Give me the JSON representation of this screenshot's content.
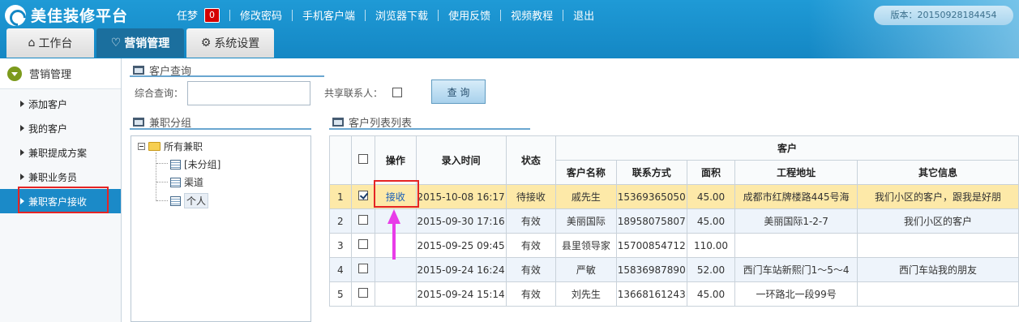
{
  "app": {
    "title": "美佳装修平台",
    "version": "版本：20150928184454"
  },
  "topnav": {
    "user": "任梦",
    "badge": "0",
    "items": [
      "修改密码",
      "手机客户端",
      "浏览器下载",
      "使用反馈",
      "视频教程",
      "退出"
    ]
  },
  "tabs": [
    {
      "label": "工作台",
      "icon": "home-icon"
    },
    {
      "label": "营销管理",
      "icon": "chat-icon"
    },
    {
      "label": "系统设置",
      "icon": "gear-icon"
    }
  ],
  "leftnav": {
    "title": "营销管理",
    "items": [
      "添加客户",
      "我的客户",
      "兼职提成方案",
      "兼职业务员",
      "兼职客户接收"
    ]
  },
  "query": {
    "section": "客户查询",
    "search_label": "综合查询：",
    "search_value": "",
    "share_label": "共享联系人：",
    "button": "查 询"
  },
  "groups": {
    "section": "兼职分组",
    "root": "所有兼职",
    "children": [
      "[未分组]",
      "渠道",
      "个人"
    ]
  },
  "list": {
    "section": "客户列表列表",
    "headers": {
      "op": "操作",
      "time": "录入时间",
      "status": "状态",
      "customer": "客户",
      "name": "客户名称",
      "contact": "联系方式",
      "area": "面积",
      "addr": "工程地址",
      "other": "其它信息"
    },
    "rows": [
      {
        "no": "1",
        "op": "接收",
        "time": "2015-10-08 16:17",
        "status": "待接收",
        "name": "戚先生",
        "contact": "15369365050",
        "area": "45.00",
        "addr": "成都市红牌楼路445号海",
        "other": "我们小区的客户，跟我是好朋"
      },
      {
        "no": "2",
        "op": "",
        "time": "2015-09-30 17:16",
        "status": "有效",
        "name": "美丽国际",
        "contact": "18958075807",
        "area": "45.00",
        "addr": "美丽国际1-2-7",
        "other": "我们小区的客户"
      },
      {
        "no": "3",
        "op": "",
        "time": "2015-09-25 09:45",
        "status": "有效",
        "name": "县里领导家",
        "contact": "15700854712",
        "area": "110.00",
        "addr": "",
        "other": ""
      },
      {
        "no": "4",
        "op": "",
        "time": "2015-09-24 16:24",
        "status": "有效",
        "name": "严敏",
        "contact": "15836987890",
        "area": "52.00",
        "addr": "西门车站新熙门1～5～4",
        "other": "西门车站我的朋友"
      },
      {
        "no": "5",
        "op": "",
        "time": "2015-09-24 15:14",
        "status": "有效",
        "name": "刘先生",
        "contact": "13668161243",
        "area": "45.00",
        "addr": "一环路北一段99号",
        "other": ""
      }
    ]
  }
}
